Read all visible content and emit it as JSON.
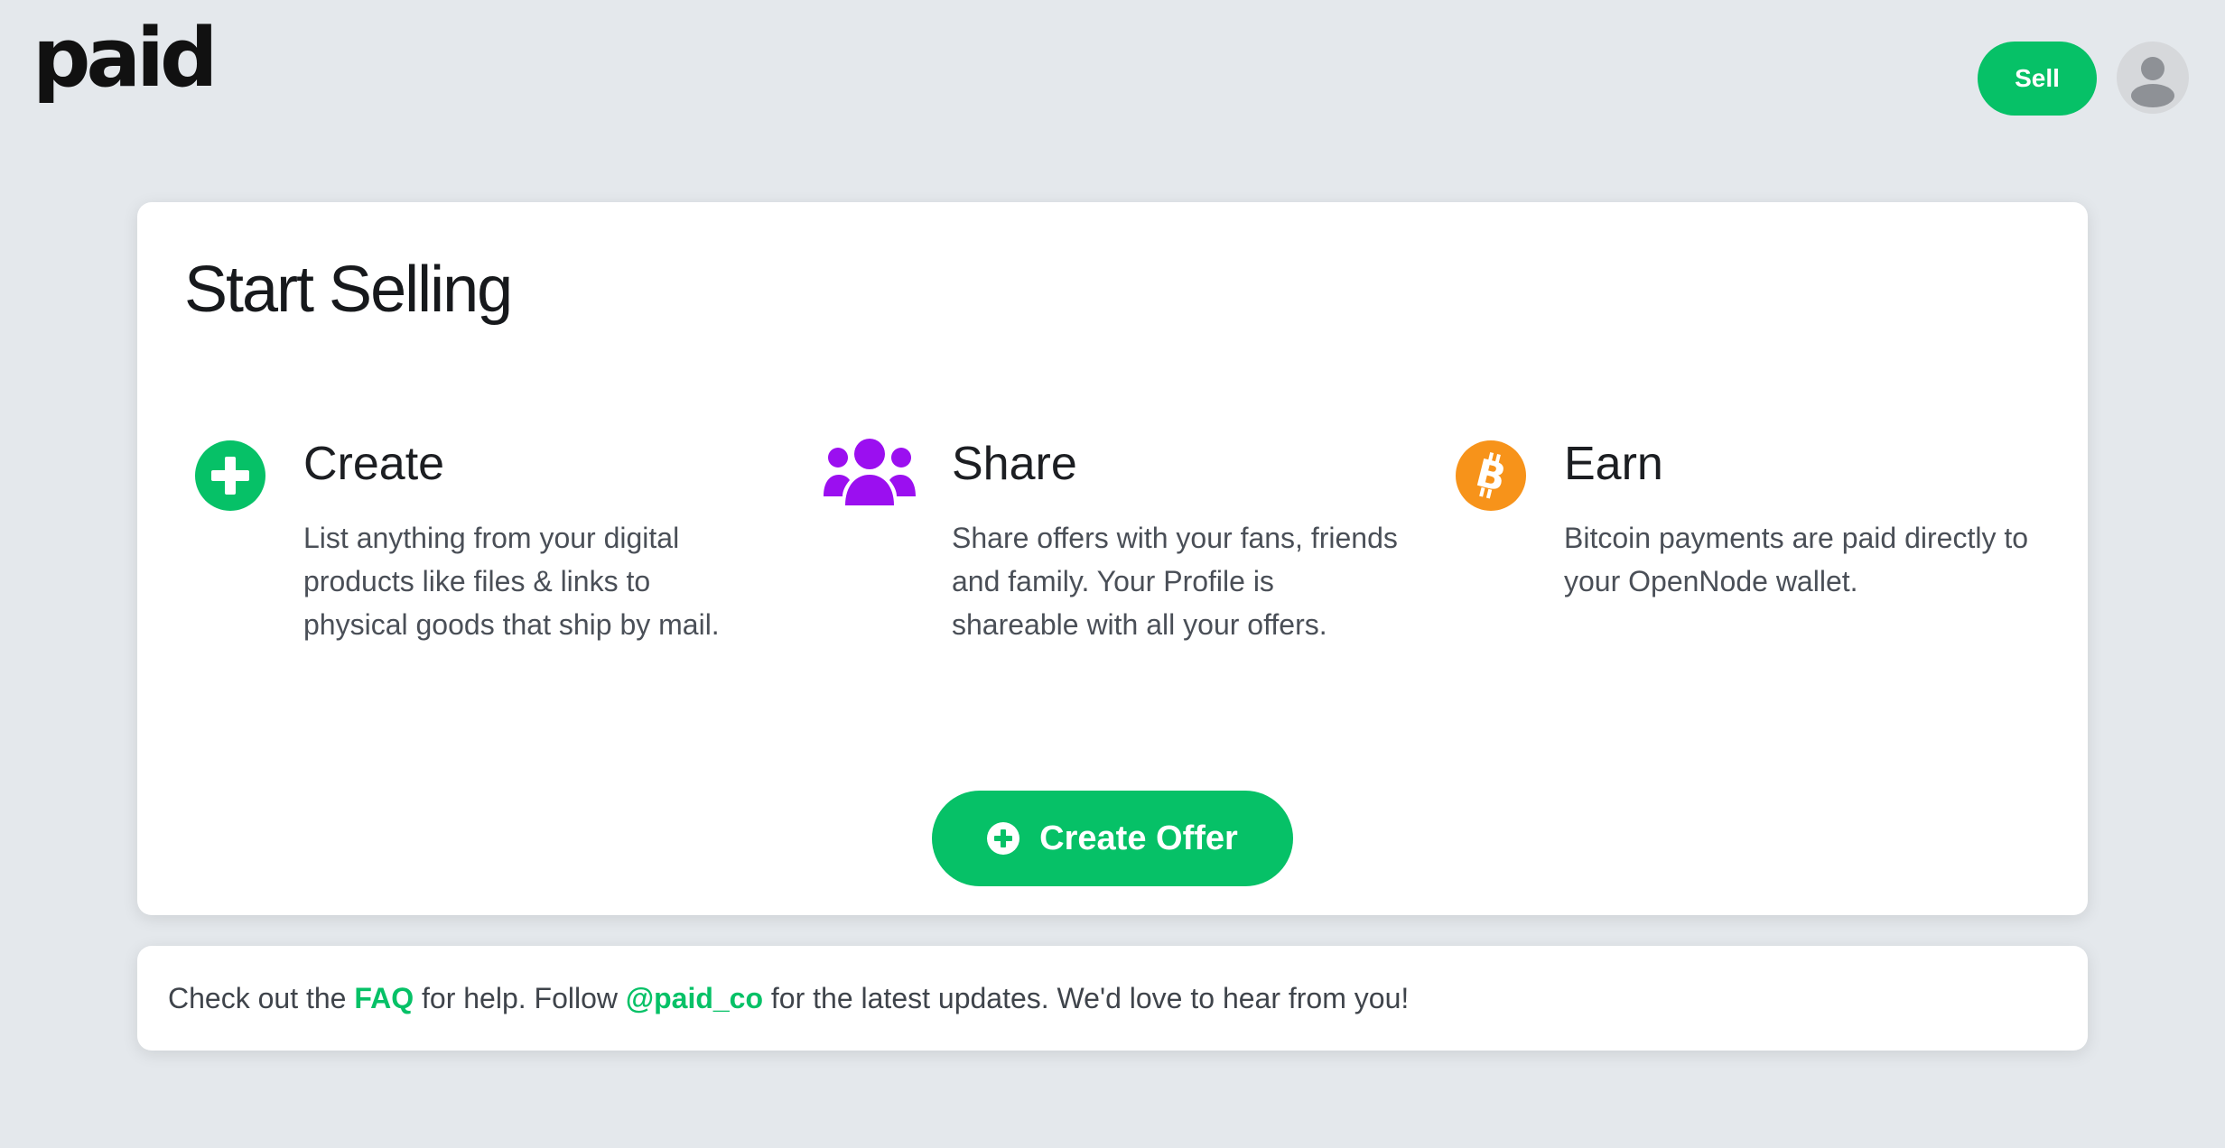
{
  "header": {
    "logo_text": "paid",
    "sell_label": "Sell",
    "avatar_icon": "user-avatar-icon"
  },
  "colors": {
    "accent": "#06c167",
    "share_icon": "#9b0ff0",
    "earn_icon": "#f7931a",
    "background": "#e4e8ec"
  },
  "card": {
    "title": "Start Selling",
    "features": [
      {
        "icon": "plus-circle-icon",
        "title": "Create",
        "description": "List anything from your digital products like files & links to physical goods that ship by mail."
      },
      {
        "icon": "users-group-icon",
        "title": "Share",
        "description": "Share offers with your fans, friends and family. Your Profile is shareable with all your offers."
      },
      {
        "icon": "bitcoin-icon",
        "title": "Earn",
        "description": "Bitcoin payments are paid directly to your OpenNode wallet."
      }
    ],
    "create_offer_label": "Create Offer"
  },
  "footer": {
    "text_1": "Check out the ",
    "faq_link": "FAQ",
    "text_2": " for help. Follow ",
    "twitter_link": "@paid_co",
    "text_3": " for the latest updates. We'd love to hear from you!"
  }
}
